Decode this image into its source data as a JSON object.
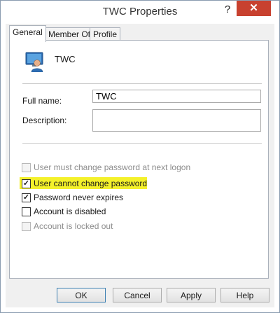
{
  "window": {
    "title": "TWC Properties",
    "help_label": "?",
    "close_label": "✕"
  },
  "tabs": [
    {
      "label": "General",
      "active": true
    },
    {
      "label": "Member Of",
      "active": false
    },
    {
      "label": "Profile",
      "active": false
    }
  ],
  "user": {
    "icon": "user-icon",
    "name": "TWC"
  },
  "form": {
    "full_name_label": "Full name:",
    "full_name_value": "TWC",
    "description_label": "Description:",
    "description_value": ""
  },
  "options": [
    {
      "label": "User must change password at next logon",
      "checked": false,
      "enabled": false,
      "highlighted": false
    },
    {
      "label": "User cannot change password",
      "checked": true,
      "enabled": true,
      "highlighted": true
    },
    {
      "label": "Password never expires",
      "checked": true,
      "enabled": true,
      "highlighted": false
    },
    {
      "label": "Account is disabled",
      "checked": false,
      "enabled": true,
      "highlighted": false
    },
    {
      "label": "Account is locked out",
      "checked": false,
      "enabled": false,
      "highlighted": false
    }
  ],
  "buttons": {
    "ok": "OK",
    "cancel": "Cancel",
    "apply": "Apply",
    "help": "Help"
  },
  "colors": {
    "close_button": "#c8412f",
    "highlight": "#f4f12b"
  }
}
